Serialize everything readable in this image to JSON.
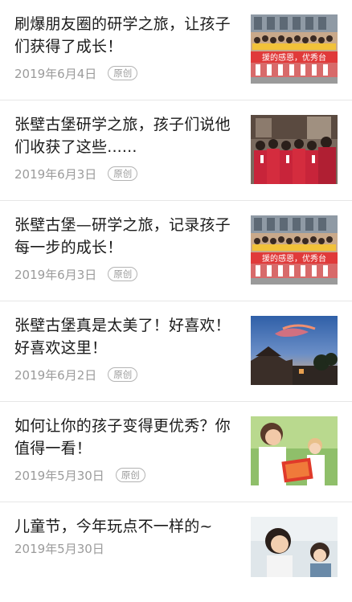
{
  "articles": [
    {
      "title": "刷爆朋友圈的研学之旅，让孩子们获得了成长！",
      "date": "2019年6月4日",
      "badge": "原创",
      "thumb": "students-banner-group-photo"
    },
    {
      "title": "张壁古堡研学之旅，孩子们说他们收获了这些......",
      "date": "2019年6月3日",
      "badge": "原创",
      "thumb": "students-red-uniform-photo"
    },
    {
      "title": "张壁古堡—研学之旅，记录孩子每一步的成长！",
      "date": "2019年6月3日",
      "badge": "原创",
      "thumb": "students-banner-group-photo"
    },
    {
      "title": "张壁古堡真是太美了！好喜欢！好喜欢这里！",
      "date": "2019年6月2日",
      "badge": "原创",
      "thumb": "ancient-castle-sunset-photo"
    },
    {
      "title": "如何让你的孩子变得更优秀？你值得一看！",
      "date": "2019年5月30日",
      "badge": "原创",
      "thumb": "mother-reading-to-child-photo"
    },
    {
      "title": "儿童节，今年玩点不一样的~",
      "date": "2019年5月30日",
      "badge": "",
      "thumb": "family-portrait-photo"
    }
  ],
  "banner_text": "援的感恩，优秀台"
}
